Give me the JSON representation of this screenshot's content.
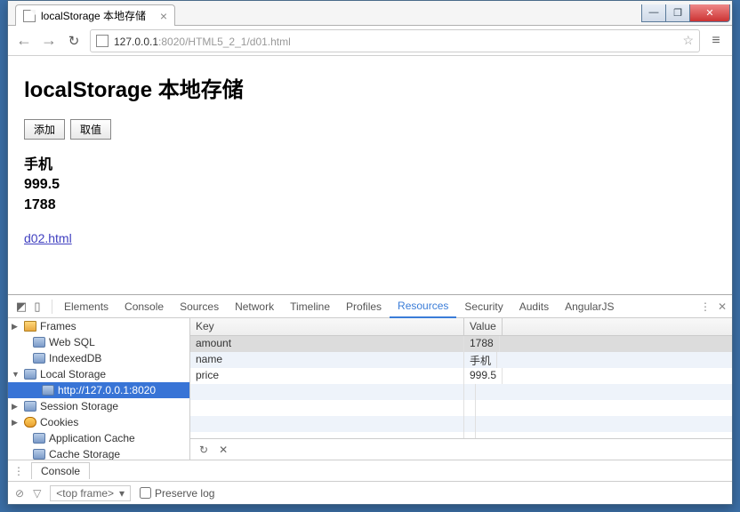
{
  "window": {
    "minimize": "—",
    "maximize": "❐",
    "close": "✕"
  },
  "tab": {
    "title": "localStorage 本地存储",
    "close": "×"
  },
  "toolbar": {
    "back": "←",
    "forward": "→",
    "reload": "↻",
    "menu": "≡",
    "star": "☆",
    "url_host": "127.0.0.1",
    "url_port": ":8020",
    "url_path": "/HTML5_2_1/d01.html"
  },
  "page": {
    "heading": "localStorage 本地存储",
    "add_btn": "添加",
    "get_btn": "取值",
    "line1": "手机",
    "line2": "999.5",
    "line3": "1788",
    "link": "d02.html"
  },
  "devtools": {
    "tabs": [
      "Elements",
      "Console",
      "Sources",
      "Network",
      "Timeline",
      "Profiles",
      "Resources",
      "Security",
      "Audits",
      "AngularJS"
    ],
    "active_tab": "Resources",
    "dots": "⋮",
    "closebtn": "✕",
    "tree": [
      {
        "label": "Frames",
        "icon": "folder",
        "arrow": "▶",
        "indent": 0
      },
      {
        "label": "Web SQL",
        "icon": "db",
        "indent": 1
      },
      {
        "label": "IndexedDB",
        "icon": "db",
        "indent": 1
      },
      {
        "label": "Local Storage",
        "icon": "db",
        "arrow": "▼",
        "indent": 0
      },
      {
        "label": "http://127.0.0.1:8020",
        "icon": "db",
        "indent": 2,
        "selected": true
      },
      {
        "label": "Session Storage",
        "icon": "db",
        "arrow": "▶",
        "indent": 0
      },
      {
        "label": "Cookies",
        "icon": "cookie",
        "arrow": "▶",
        "indent": 0
      },
      {
        "label": "Application Cache",
        "icon": "db",
        "indent": 1
      },
      {
        "label": "Cache Storage",
        "icon": "db",
        "indent": 1
      }
    ],
    "columns": [
      "Key",
      "Value"
    ],
    "rows": [
      {
        "k": "amount",
        "v": "1788",
        "sel": true
      },
      {
        "k": "name",
        "v": "手机"
      },
      {
        "k": "price",
        "v": "999.5"
      }
    ],
    "footer": {
      "refresh": "↻",
      "delete": "✕"
    },
    "console_tab": "Console",
    "bottom": {
      "stop": "⊘",
      "filter": "▽",
      "frame": "<top frame>",
      "arrow": "▾",
      "preserve": "Preserve log"
    }
  }
}
